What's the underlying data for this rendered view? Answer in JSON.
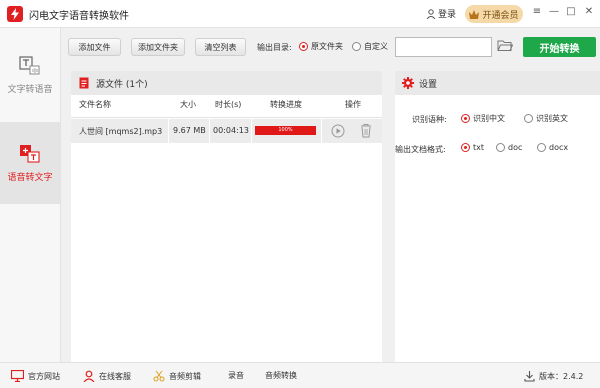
{
  "titlebar": {
    "app_title": "闪电文字语音转换软件",
    "login_label": "登录",
    "vip_label": "开通会员",
    "menu_icon": "≡",
    "minimize_icon": "—",
    "maximize_icon": "□",
    "close_icon": "✕"
  },
  "sidebar": {
    "items": [
      {
        "label": "文字转语音",
        "icon": "text-to-speech-icon",
        "active": false
      },
      {
        "label": "语音转文字",
        "icon": "speech-to-text-icon",
        "active": true
      }
    ]
  },
  "toolbar": {
    "add_file": "添加文件",
    "add_folder": "添加文件夹",
    "clear_list": "清空列表",
    "output_dir_label": "输出目录:",
    "output_source": "原文件夹",
    "output_custom": "自定义",
    "output_path_value": "",
    "start_button": "开始转换"
  },
  "file_panel": {
    "title": "源文件 (1个)",
    "columns": [
      "文件名称",
      "大小",
      "时长(s)",
      "转换进度",
      "操作"
    ],
    "rows": [
      {
        "name": "人世间 [mqms2].mp3",
        "size": "9.67 MB",
        "duration": "00:04:13",
        "progress": 1.0,
        "progress_label": "100%"
      }
    ]
  },
  "settings": {
    "title": "设置",
    "language_label": "识别语种:",
    "language_options": [
      "识别中文",
      "识别英文"
    ],
    "language_selected": "识别中文",
    "format_label": "输出文档格式:",
    "format_options": [
      "txt",
      "doc",
      "docx"
    ],
    "format_selected": "txt"
  },
  "statusbar": {
    "website": "官方网站",
    "service": "在线客服",
    "audio_cut": "音频剪辑",
    "record": "录音",
    "audio_convert": "音频转换",
    "version": "版本：2.4.2"
  },
  "colors": {
    "accent_red": "#e02020",
    "start_green": "#1ea84a",
    "vip_gold": "#f5d9a8"
  }
}
